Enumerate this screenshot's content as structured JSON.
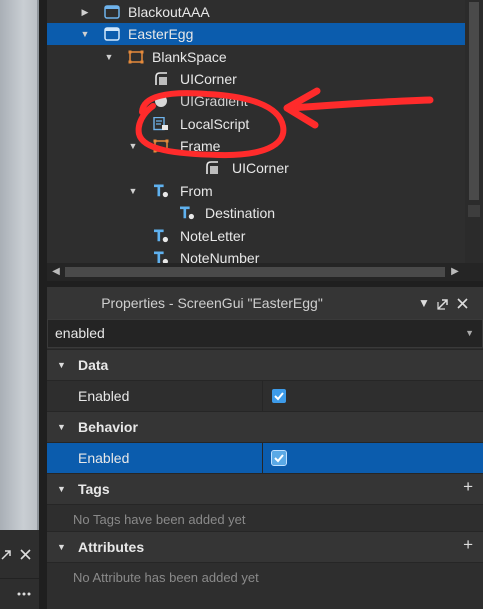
{
  "explorer": {
    "items": [
      {
        "label": "BlackoutAAA",
        "icon": "screengui-icon",
        "expander": "collapsed"
      },
      {
        "label": "EasterEgg",
        "icon": "screengui-icon",
        "expander": "expanded",
        "selected": true
      },
      {
        "label": "BlankSpace",
        "icon": "frame-icon",
        "expander": "expanded"
      },
      {
        "label": "UICorner",
        "icon": "uicorner-icon"
      },
      {
        "label": "UIGradient",
        "icon": "uigradient-icon"
      },
      {
        "label": "LocalScript",
        "icon": "localscript-icon"
      },
      {
        "label": "Frame",
        "icon": "frame-icon",
        "expander": "expanded"
      },
      {
        "label": "UICorner",
        "icon": "uicorner-icon"
      },
      {
        "label": "From",
        "icon": "textlabel-icon",
        "expander": "expanded"
      },
      {
        "label": "Destination",
        "icon": "textlabel-icon"
      },
      {
        "label": "NoteLetter",
        "icon": "textlabel-icon"
      },
      {
        "label": "NoteNumber",
        "icon": "textlabel-icon"
      }
    ]
  },
  "properties": {
    "title": "Properties - ScreenGui \"EasterEgg\"",
    "filter_value": "enabled",
    "categories": [
      {
        "label": "Data",
        "rows": [
          {
            "name": "Enabled",
            "checked": true
          }
        ]
      },
      {
        "label": "Behavior",
        "rows": [
          {
            "name": "Enabled",
            "checked": true,
            "selected": true
          }
        ]
      },
      {
        "label": "Tags",
        "empty_text": "No Tags have been added yet"
      },
      {
        "label": "Attributes",
        "empty_text": "No Attribute has been added yet"
      }
    ]
  },
  "colors": {
    "selection": "#0b5cad",
    "annotation": "#ff2b2b",
    "checkbox": "#3d9be9"
  }
}
